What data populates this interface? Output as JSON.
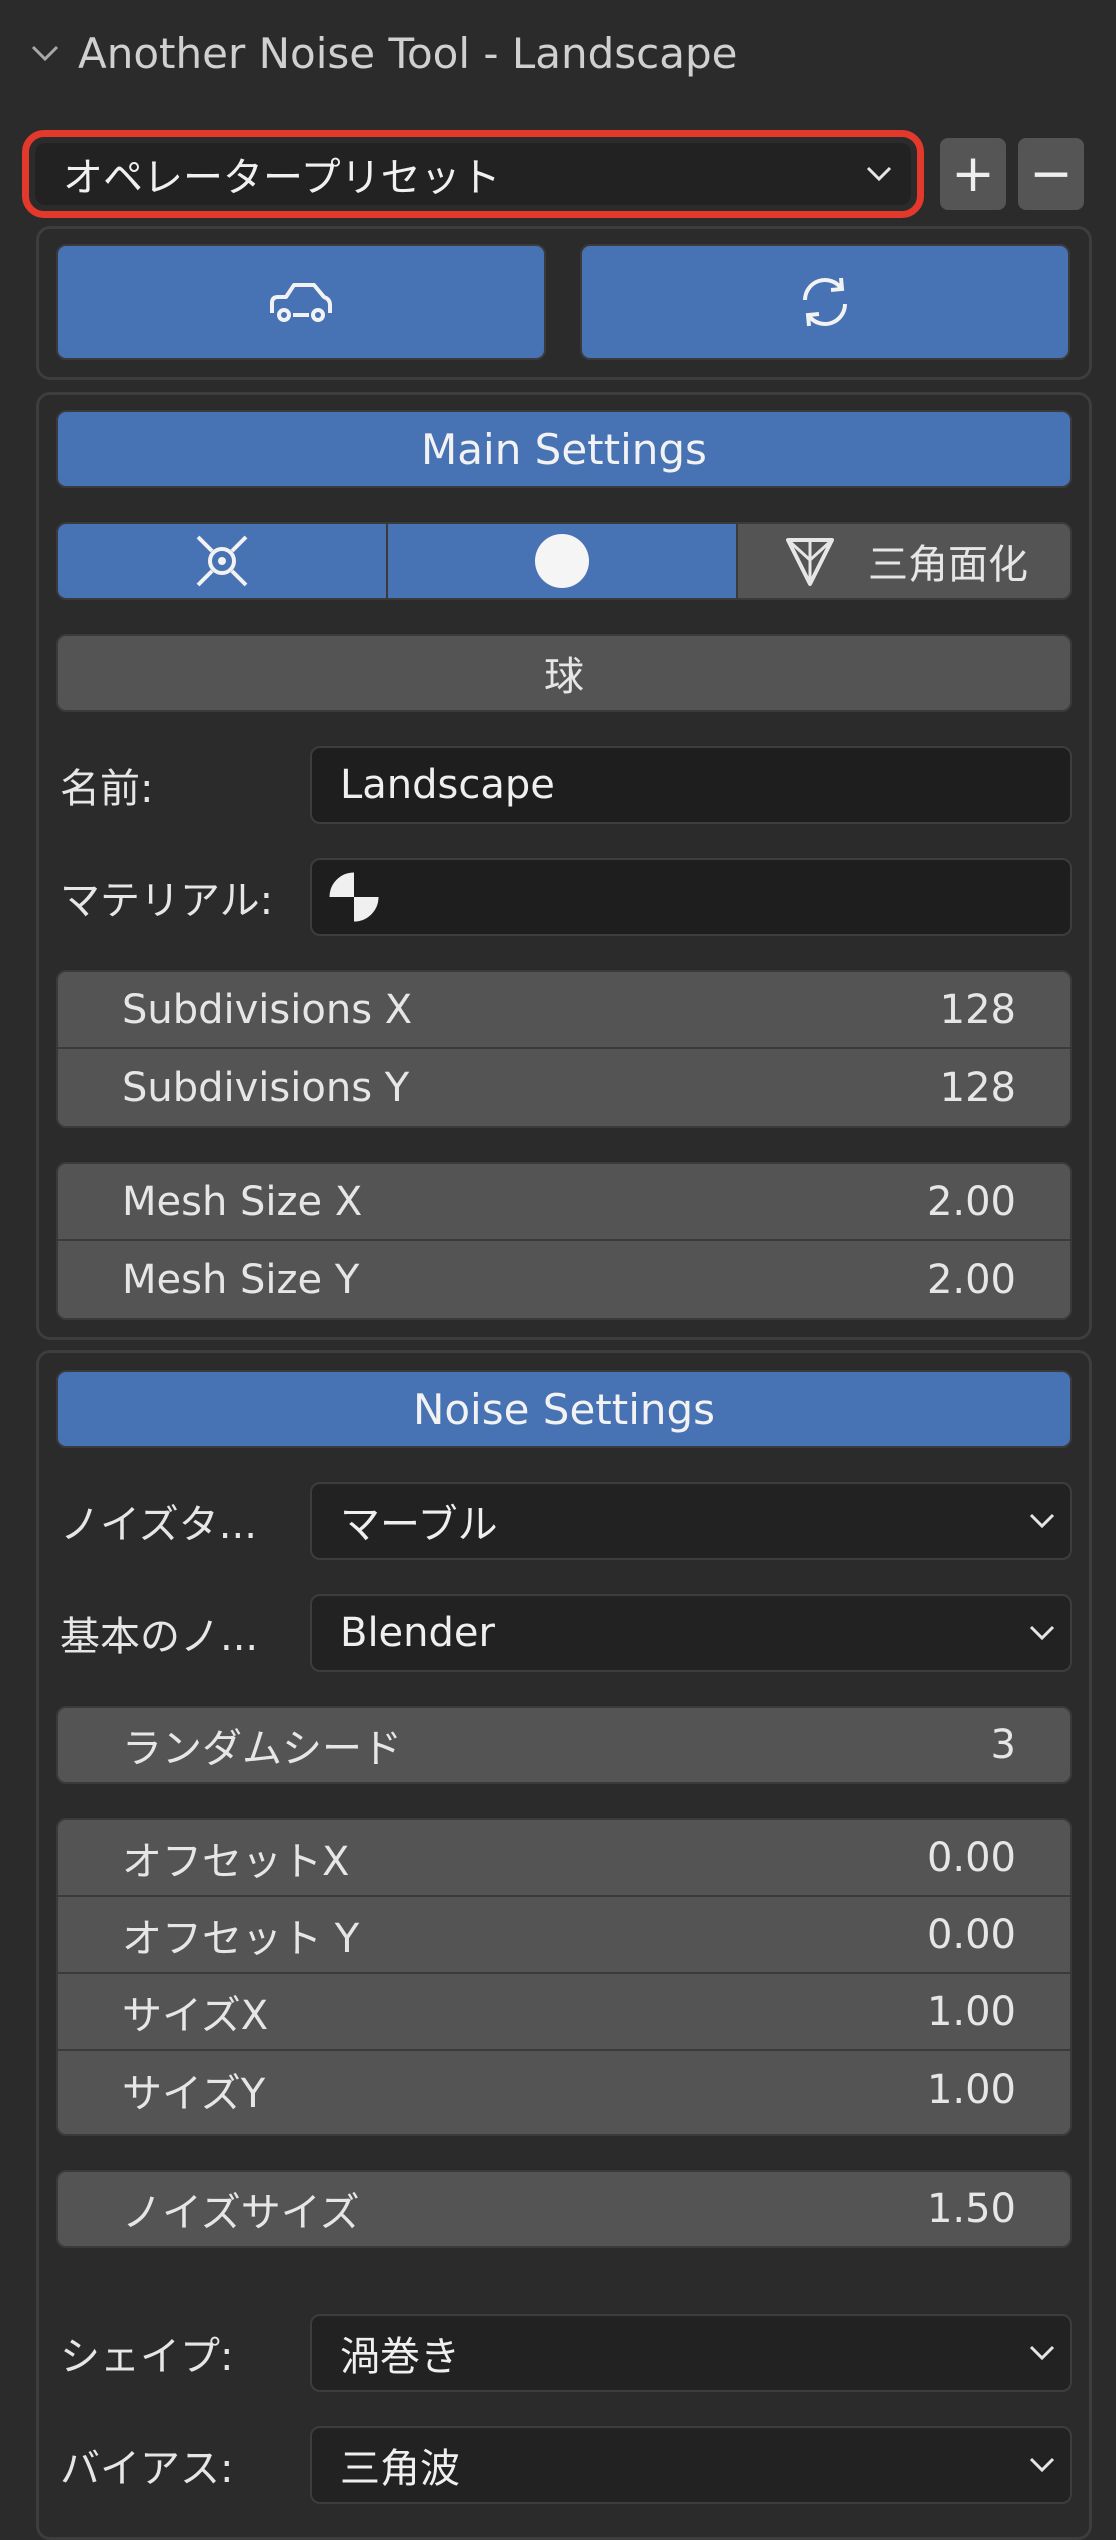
{
  "panel": {
    "title": "Another Noise Tool - Landscape"
  },
  "preset": {
    "label": "オペレータープリセット",
    "add": "+",
    "remove": "−"
  },
  "main_settings": {
    "header": "Main Settings",
    "triangulate_label": "三角面化",
    "sphere_label": "球",
    "name_label": "名前:",
    "name_value": "Landscape",
    "material_label": "マテリアル:",
    "subdivisions": [
      {
        "label": "Subdivisions X",
        "value": "128"
      },
      {
        "label": "Subdivisions Y",
        "value": "128"
      }
    ],
    "mesh_size": [
      {
        "label": "Mesh Size X",
        "value": "2.00"
      },
      {
        "label": "Mesh Size Y",
        "value": "2.00"
      }
    ]
  },
  "noise_settings": {
    "header": "Noise Settings",
    "noise_type_label": "ノイズタ...",
    "noise_type_value": "マーブル",
    "basis_label": "基本のノ...",
    "basis_value": "Blender",
    "seed": {
      "label": "ランダムシード",
      "value": "3"
    },
    "offset_size": [
      {
        "label": "オフセットX",
        "value": "0.00"
      },
      {
        "label": "オフセット Y",
        "value": "0.00"
      },
      {
        "label": "サイズX",
        "value": "1.00"
      },
      {
        "label": "サイズY",
        "value": "1.00"
      }
    ],
    "noise_size": {
      "label": "ノイズサイズ",
      "value": "1.50"
    },
    "shape_label": "シェイプ:",
    "shape_value": "渦巻き",
    "bias_label": "バイアス:",
    "bias_value": "三角波"
  },
  "colors": {
    "accent": "#4772b3",
    "highlight": "#e2392c",
    "background": "#2b2b2b"
  },
  "icons": [
    "chevron-down-icon",
    "car-icon",
    "refresh-icon",
    "object-center-icon",
    "sphere-icon",
    "triangulate-icon",
    "material-icon"
  ]
}
